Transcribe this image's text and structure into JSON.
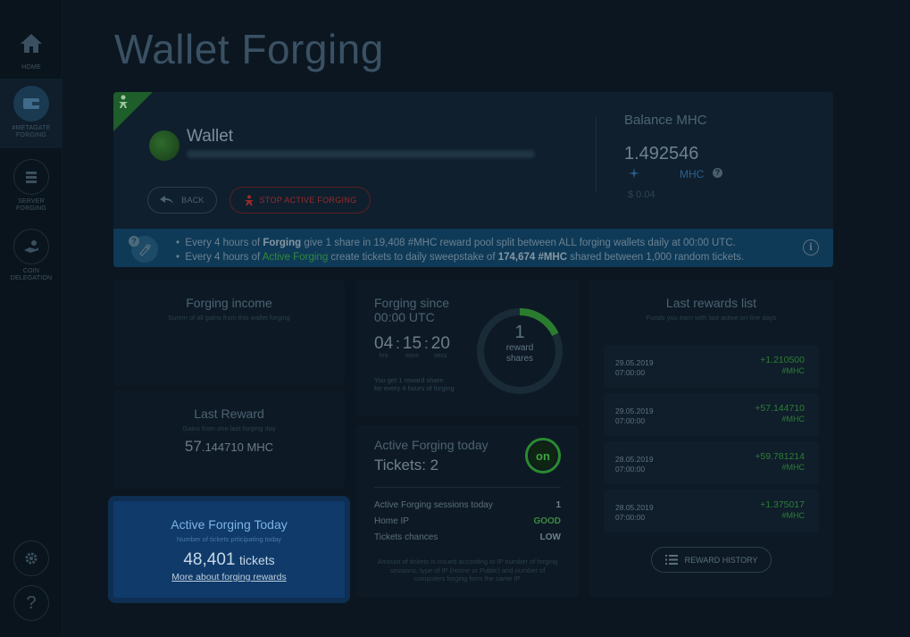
{
  "sidebar": {
    "items": [
      {
        "label": "HOME",
        "icon": "home-icon"
      },
      {
        "label": "#METAGATE FORGING",
        "icon": "wallet-icon"
      },
      {
        "label": "SERVER FORGING",
        "icon": "server-icon"
      },
      {
        "label": "COIN DELEGATION",
        "icon": "delegation-icon"
      }
    ],
    "settings_icon": "gear-icon",
    "help_label": "?"
  },
  "page": {
    "title": "Wallet Forging"
  },
  "wallet": {
    "name": "Wallet",
    "back_label": "BACK",
    "stop_label": "STOP ACTIVE FORGING",
    "balance_title": "Balance MHC",
    "balance_value": "1.492546",
    "balance_unit": "MHC",
    "balance_usd": "$ 0.04",
    "info_line1": {
      "pre": "Every 4 hours of ",
      "bold1": "Forging",
      "mid": " give 1 share in 19,408 #MHC reward pool split between ALL forging wallets daily at 00:00 UTC."
    },
    "info_line2": {
      "pre": "Every 4 hours of ",
      "green": "Active Forging",
      "mid": " create tickets to daily sweepstake of ",
      "bold": "174,674 #MHC",
      "post": " shared between 1,000 random tickets."
    }
  },
  "income": {
    "title": "Forging income",
    "subtitle": "Summ of all gains from this wallet forging"
  },
  "last_reward": {
    "title": "Last Reward",
    "subtitle": "Gains from one last forging day",
    "value_big": "57",
    "value_small": ".144710 MHC"
  },
  "active_today": {
    "title": "Active Forging Today",
    "subtitle": "Number of tickets prticipating today",
    "value": "48,401",
    "unit": "tickets",
    "link": "More about forging rewards"
  },
  "forging_since": {
    "title_line1": "Forging since",
    "title_line2": "00:00 UTC",
    "hours": "04",
    "hours_label": "hrs",
    "mins": "15",
    "mins_label": "mins",
    "secs": "20",
    "secs_label": "secs",
    "note_line1": "You get 1 reward share",
    "note_line2": "for every 4 hours of forging",
    "ring_value": "1",
    "ring_label_1": "reward",
    "ring_label_2": "shares",
    "ring_progress": 0.18
  },
  "active_forging": {
    "title": "Active Forging today",
    "tickets": "Tickets: 2",
    "badge": "on",
    "stats": [
      {
        "label": "Active Forging sessions today",
        "value": "1"
      },
      {
        "label": "Home IP",
        "value": "GOOD"
      },
      {
        "label": "Tickets chances",
        "value": "LOW"
      }
    ],
    "note": "Amount of tickets is issued according to IP number of forging sessions, type of IP (Home or Public) and number of computers forging form the same IP."
  },
  "rewards": {
    "title": "Last rewards list",
    "subtitle": "Funds you earn with last active on-line days",
    "items": [
      {
        "date": "29.05.2019",
        "time": "07:00:00",
        "amount": "+1.210500",
        "unit": "#MHC"
      },
      {
        "date": "29.05.2019",
        "time": "07:00:00",
        "amount": "+57.144710",
        "unit": "#MHC"
      },
      {
        "date": "28.05.2019",
        "time": "07:00:00",
        "amount": "+59.781214",
        "unit": "#MHC"
      },
      {
        "date": "28.05.2019",
        "time": "07:00:00",
        "amount": "+1.375017",
        "unit": "#MHC"
      }
    ],
    "history_label": "REWARD HISTORY"
  },
  "colors": {
    "accent_green": "#2f8a3a",
    "stop_red": "#9a2a2a",
    "active_blue": "#0f3a6a"
  }
}
